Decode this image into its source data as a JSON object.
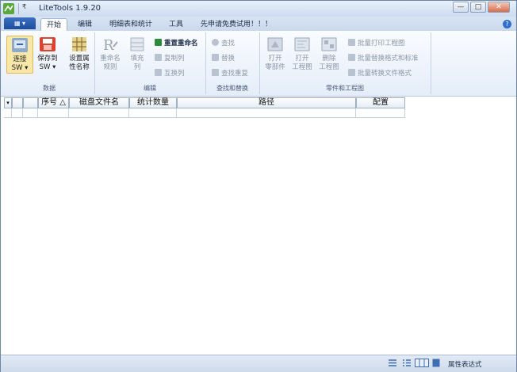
{
  "window": {
    "title": "LiteTools 1.9.20",
    "qat_dropdown": "₹"
  },
  "title_buttons": {
    "minimize": "—",
    "maximize": "□",
    "close": "✕"
  },
  "app_button": {
    "label": "▦ ▾"
  },
  "tabs": [
    {
      "label": "开始",
      "active": true
    },
    {
      "label": "编辑",
      "active": false
    },
    {
      "label": "明细表和统计",
      "active": false
    },
    {
      "label": "工具",
      "active": false
    },
    {
      "label": "先申请免费试用！！！",
      "active": false
    }
  ],
  "help": {
    "label": "?"
  },
  "ribbon": {
    "data_group": {
      "label": "数据",
      "connect": {
        "line1": "连接",
        "line2": "SW ▾"
      },
      "save": {
        "line1": "保存到",
        "line2": "SW ▾"
      },
      "attr_name": {
        "line1": "设置属",
        "line2": "性名称"
      }
    },
    "edit_group": {
      "label": "编辑",
      "rename_rule": {
        "line1": "重命名",
        "line2": "规则"
      },
      "fill_col": {
        "line1": "填充",
        "line2": "列"
      },
      "batch_rename": "重置重命名",
      "copy_col": "复制列",
      "swap_col": "互换列"
    },
    "find_group": {
      "label": "查找和替换",
      "find": "查找",
      "replace": "替换",
      "find_dup": "查找重复"
    },
    "parts_group": {
      "label": "零件和工程图",
      "open_part": {
        "line1": "打开",
        "line2": "零部件"
      },
      "open_drawing": {
        "line1": "打开",
        "line2": "工程图"
      },
      "delete_drawing": {
        "line1": "删除",
        "line2": "工程图"
      },
      "batch_print": "批量打印工程图",
      "batch_replace_format": "批量替换格式和标准",
      "batch_convert": "批量转换文件格式"
    }
  },
  "grid": {
    "columns": [
      {
        "label": ""
      },
      {
        "label": ""
      },
      {
        "label": "序号 △"
      },
      {
        "label": "磁盘文件名"
      },
      {
        "label": "统计数量"
      },
      {
        "label": "路径"
      },
      {
        "label": "配置"
      }
    ],
    "corner_glyph": "▾"
  },
  "statusbar": {
    "text": "属性表达式"
  }
}
